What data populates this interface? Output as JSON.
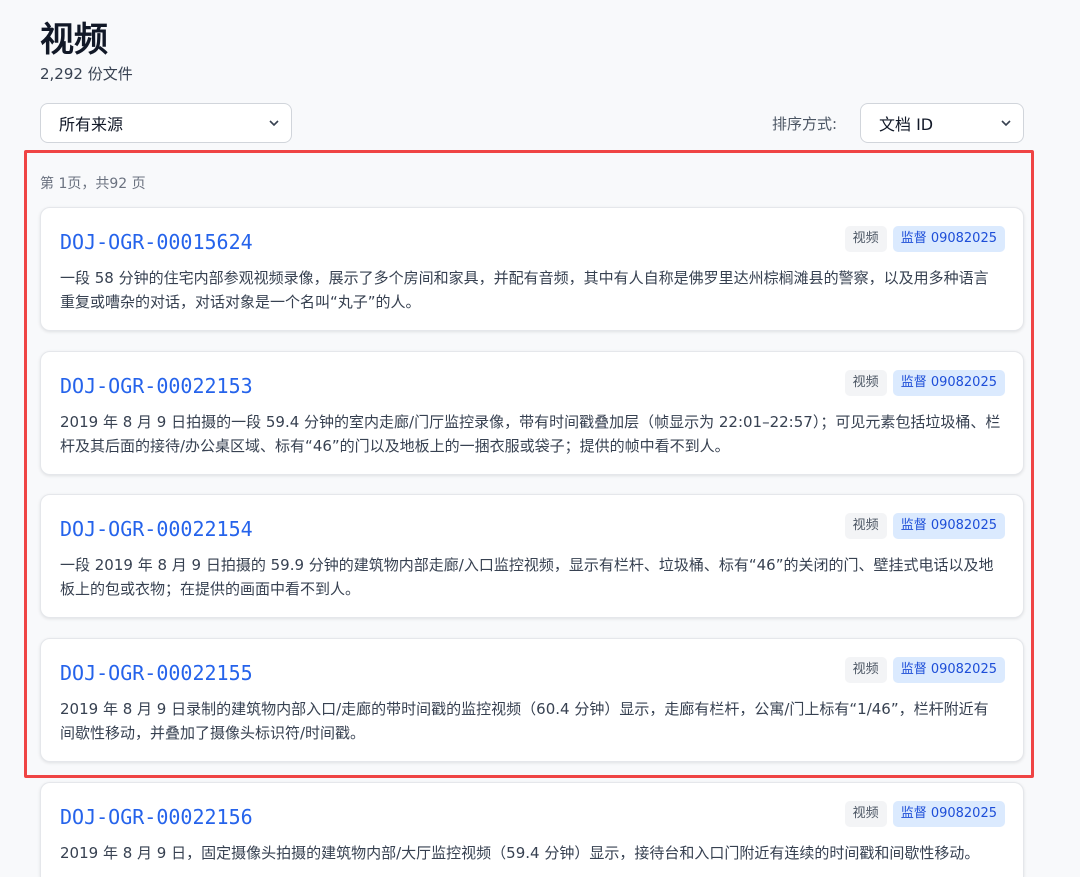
{
  "header": {
    "title": "视频",
    "file_count": "2,292 份文件"
  },
  "filters": {
    "source_selected": "所有来源",
    "sort_label": "排序方式:",
    "sort_selected": "文档 ID"
  },
  "pagination": {
    "info": "第 1页，共92 页"
  },
  "documents": [
    {
      "id": "DOJ-OGR-00015624",
      "type": "视频",
      "source": "监督 09082025",
      "description": "一段 58 分钟的住宅内部参观视频录像，展示了多个房间和家具，并配有音频，其中有人自称是佛罗里达州棕榈滩县的警察，以及用多种语言重复或嘈杂的对话，对话对象是一个名叫“丸子”的人。"
    },
    {
      "id": "DOJ-OGR-00022153",
      "type": "视频",
      "source": "监督 09082025",
      "description": "2019 年 8 月 9 日拍摄的一段 59.4 分钟的室内走廊/门厅监控录像，带有时间戳叠加层（帧显示为 22:01–22:57）；可见元素包括垃圾桶、栏杆及其后面的接待/办公桌区域、标有“46”的门以及地板上的一捆衣服或袋子；提供的帧中看不到人。"
    },
    {
      "id": "DOJ-OGR-00022154",
      "type": "视频",
      "source": "监督 09082025",
      "description": "一段 2019 年 8 月 9 日拍摄的 59.9 分钟的建筑物内部走廊/入口监控视频，显示有栏杆、垃圾桶、标有“46”的关闭的门、壁挂式电话以及地板上的包或衣物；在提供的画面中看不到人。"
    },
    {
      "id": "DOJ-OGR-00022155",
      "type": "视频",
      "source": "监督 09082025",
      "description": "2019 年 8 月 9 日录制的建筑物内部入口/走廊的带时间戳的监控视频（60.4 分钟）显示，走廊有栏杆，公寓/门上标有“1/46”，栏杆附近有间歇性移动，并叠加了摄像头标识符/时间戳。"
    },
    {
      "id": "DOJ-OGR-00022156",
      "type": "视频",
      "source": "监督 09082025",
      "description": "2019 年 8 月 9 日，固定摄像头拍摄的建筑物内部/大厅监控视频（59.4 分钟）显示，接待台和入口门附近有连续的时间戳和间歇性移动。"
    }
  ],
  "colors": {
    "link": "#2563eb",
    "highlight_border": "#ef4444",
    "badge_source_bg": "#dbeafe"
  }
}
